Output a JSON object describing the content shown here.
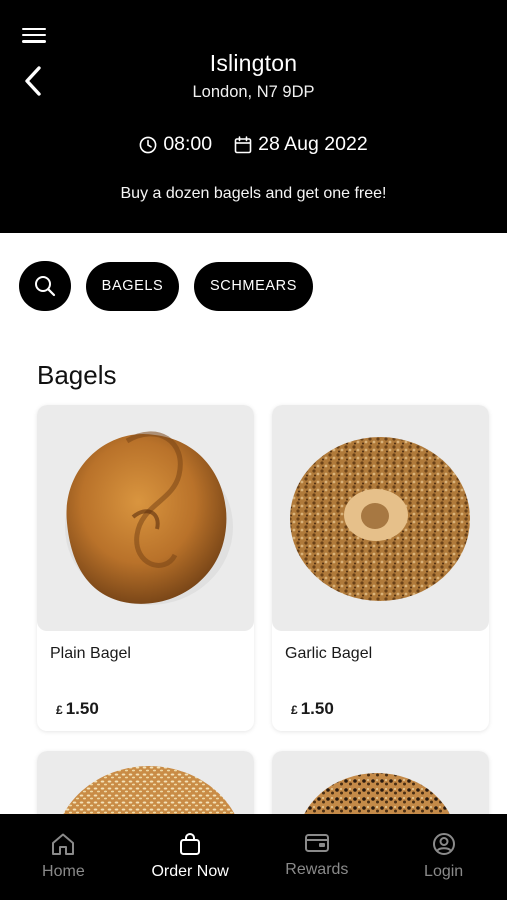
{
  "header": {
    "store_name": "Islington",
    "store_address": "London, N7 9DP",
    "pickup_time": "08:00",
    "pickup_date": "28 Aug 2022",
    "promo_text": "Buy a dozen bagels and get one free!"
  },
  "filters": {
    "search_icon": "search-icon",
    "chips": [
      "BAGELS",
      "SCHMEARS"
    ]
  },
  "section": {
    "title": "Bagels",
    "products": [
      {
        "name": "Plain Bagel",
        "currency": "£",
        "price": "1.50"
      },
      {
        "name": "Garlic Bagel",
        "currency": "£",
        "price": "1.50"
      },
      {
        "name": "",
        "currency": "",
        "price": ""
      },
      {
        "name": "",
        "currency": "",
        "price": ""
      }
    ]
  },
  "bottom_nav": {
    "items": [
      {
        "label": "Home",
        "icon": "home-icon",
        "active": false
      },
      {
        "label": "Order Now",
        "icon": "shopping-bag-icon",
        "active": true
      },
      {
        "label": "Rewards",
        "icon": "wallet-icon",
        "active": false
      },
      {
        "label": "Login",
        "icon": "user-icon",
        "active": false
      }
    ]
  },
  "colors": {
    "header_bg": "#000000",
    "nav_bg": "#000000",
    "nav_inactive": "#8a8a8a",
    "nav_active": "#ffffff"
  }
}
